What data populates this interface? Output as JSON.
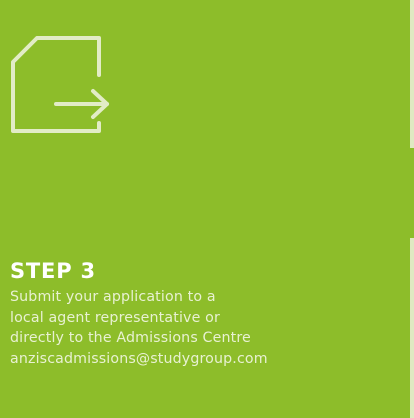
{
  "step": {
    "icon": "document-arrow-out-icon",
    "title": "STEP 3",
    "description_lines": [
      "Submit your application to a",
      "local agent representative or",
      "directly to the Admissions Centre"
    ],
    "email": "anziscadmissions@studygroup.com"
  },
  "colors": {
    "background": "#8dbd2a",
    "icon_stroke": "#e2ecc6",
    "title": "#ffffff",
    "text": "#e8f1d2"
  }
}
